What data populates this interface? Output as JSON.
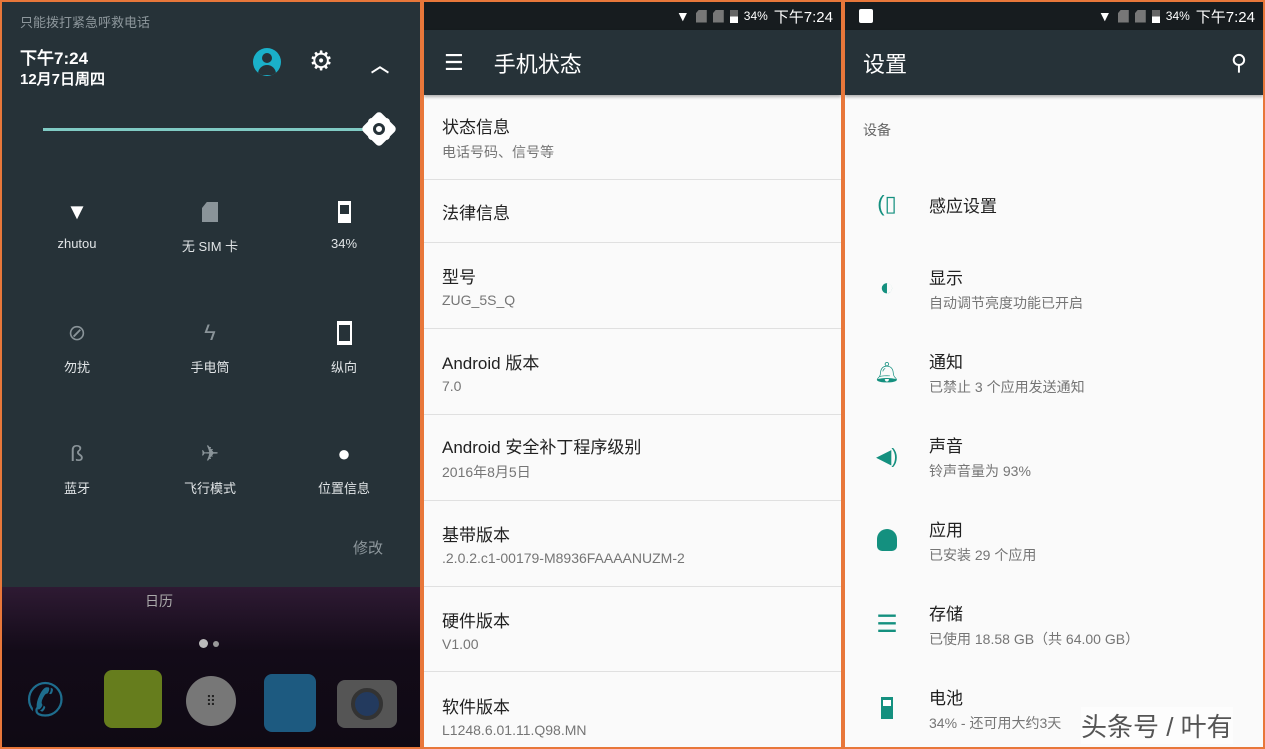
{
  "left": {
    "emergency_text": "只能拨打紧急呼救电话",
    "time": "下午7:24",
    "date": "12月7日周四",
    "brightness_fraction": 1.0,
    "tiles": [
      {
        "label": "zhutou",
        "icon": "wifi-icon"
      },
      {
        "label": "无 SIM 卡",
        "icon": "no-sim-icon"
      },
      {
        "label": "34%",
        "icon": "battery-icon"
      },
      {
        "label": "勿扰",
        "icon": "do-not-disturb-icon"
      },
      {
        "label": "手电筒",
        "icon": "flashlight-off-icon"
      },
      {
        "label": "纵向",
        "icon": "portrait-icon"
      },
      {
        "label": "蓝牙",
        "icon": "bluetooth-off-icon"
      },
      {
        "label": "飞行模式",
        "icon": "airplane-icon"
      },
      {
        "label": "位置信息",
        "icon": "location-icon"
      }
    ],
    "edit": "修改",
    "calendar_label": "日历"
  },
  "status": {
    "battery": "34%",
    "time": "下午7:24"
  },
  "middle": {
    "title": "手机状态",
    "items": [
      {
        "title": "状态信息",
        "sub": "电话号码、信号等"
      },
      {
        "title": "法律信息"
      },
      {
        "title": "型号",
        "sub": "ZUG_5S_Q"
      },
      {
        "title": "Android 版本",
        "sub": "7.0"
      },
      {
        "title": "Android 安全补丁程序级别",
        "sub": "2016年8月5日"
      },
      {
        "title": "基带版本",
        "sub": ".2.0.2.c1-00179-M8936FAAAANUZM-2"
      },
      {
        "title": "硬件版本",
        "sub": "V1.00"
      },
      {
        "title": "软件版本",
        "sub": "L1248.6.01.11.Q98.MN"
      }
    ]
  },
  "right": {
    "title": "设置",
    "section": "设备",
    "items": [
      {
        "title": "感应设置",
        "icon": "gesture-icon"
      },
      {
        "title": "显示",
        "sub": "自动调节亮度功能已开启",
        "icon": "brightness-icon"
      },
      {
        "title": "通知",
        "sub": "已禁止 3 个应用发送通知",
        "icon": "bell-icon"
      },
      {
        "title": "声音",
        "sub": "铃声音量为 93%",
        "icon": "volume-icon"
      },
      {
        "title": "应用",
        "sub": "已安装 29 个应用",
        "icon": "android-icon"
      },
      {
        "title": "存储",
        "sub": "已使用 18.58 GB（共 64.00 GB）",
        "icon": "storage-icon"
      },
      {
        "title": "电池",
        "sub": "34% - 还可用大约3天",
        "icon": "battery-icon"
      }
    ]
  },
  "watermark": "头条号 / 叶有",
  "colors": {
    "accent": "#14907f",
    "toolbar": "#263238",
    "border": "#e8773a"
  }
}
